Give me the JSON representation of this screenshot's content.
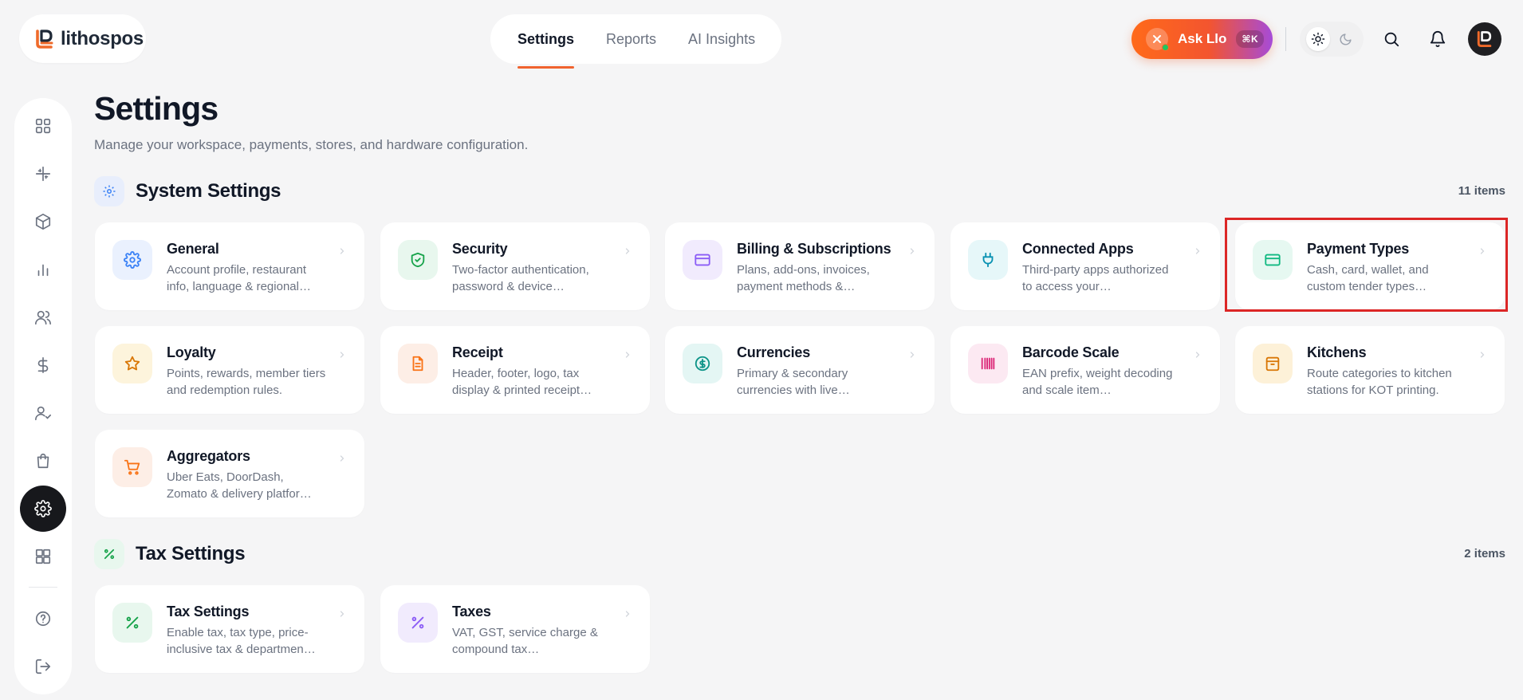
{
  "brand": {
    "name": "lithospos"
  },
  "topnav": {
    "tabs": [
      {
        "label": "Settings",
        "active": true
      },
      {
        "label": "Reports",
        "active": false
      },
      {
        "label": "AI Insights",
        "active": false
      }
    ]
  },
  "header": {
    "ask_label": "Ask Llo",
    "ask_shortcut": "⌘K",
    "theme": "light"
  },
  "sidebar": {
    "items": [
      {
        "icon": "grid-icon",
        "active": false
      },
      {
        "icon": "sparkle-icon",
        "active": false
      },
      {
        "icon": "box-icon",
        "active": false
      },
      {
        "icon": "bar-chart-icon",
        "active": false
      },
      {
        "icon": "users-icon",
        "active": false
      },
      {
        "icon": "dollar-icon",
        "active": false
      },
      {
        "icon": "user-check-icon",
        "active": false
      },
      {
        "icon": "shopping-bag-icon",
        "active": false
      },
      {
        "icon": "gear-icon",
        "active": true
      },
      {
        "icon": "apps-icon",
        "active": false
      }
    ],
    "bottom": [
      {
        "icon": "help-icon"
      },
      {
        "icon": "logout-icon"
      }
    ]
  },
  "page": {
    "title": "Settings",
    "subtitle": "Manage your workspace, payments, stores, and hardware configuration."
  },
  "sections": {
    "system": {
      "title": "System Settings",
      "count": "11 items",
      "cards": [
        {
          "title": "General",
          "desc": "Account profile, restaurant info, language & regional…",
          "icon": "gear-icon",
          "color": "#3b82f6"
        },
        {
          "title": "Security",
          "desc": "Two-factor authentication, password & device…",
          "icon": "shield-icon",
          "color": "#16a34a"
        },
        {
          "title": "Billing & Subscriptions",
          "desc": "Plans, add-ons, invoices, payment methods &…",
          "icon": "credit-card-icon",
          "color": "#8b5cf6"
        },
        {
          "title": "Connected Apps",
          "desc": "Third-party apps authorized to access your…",
          "icon": "plug-icon",
          "color": "#0891b2"
        },
        {
          "title": "Payment Types",
          "desc": "Cash, card, wallet, and custom tender types…",
          "icon": "card-icon",
          "color": "#10b981"
        },
        {
          "title": "Loyalty",
          "desc": "Points, rewards, member tiers and redemption rules.",
          "icon": "star-icon",
          "color": "#d97706"
        },
        {
          "title": "Receipt",
          "desc": "Header, footer, logo, tax display & printed receipt…",
          "icon": "receipt-icon",
          "color": "#f97316"
        },
        {
          "title": "Currencies",
          "desc": "Primary & secondary currencies with live…",
          "icon": "currency-icon",
          "color": "#0d9488"
        },
        {
          "title": "Barcode Scale",
          "desc": "EAN prefix, weight decoding and scale item…",
          "icon": "barcode-icon",
          "color": "#db2777"
        },
        {
          "title": "Kitchens",
          "desc": "Route categories to kitchen stations for KOT printing.",
          "icon": "archive-icon",
          "color": "#d97706"
        },
        {
          "title": "Aggregators",
          "desc": "Uber Eats, DoorDash, Zomato & delivery platfor…",
          "icon": "cart-icon",
          "color": "#f97316"
        }
      ]
    },
    "tax": {
      "title": "Tax Settings",
      "count": "2 items",
      "cards": [
        {
          "title": "Tax Settings",
          "desc": "Enable tax, tax type, price-inclusive tax & departmen…",
          "icon": "percent-icon",
          "color": "#16a34a"
        },
        {
          "title": "Taxes",
          "desc": "VAT, GST, service charge & compound tax…",
          "icon": "percent-icon",
          "color": "#8b5cf6"
        }
      ]
    }
  }
}
